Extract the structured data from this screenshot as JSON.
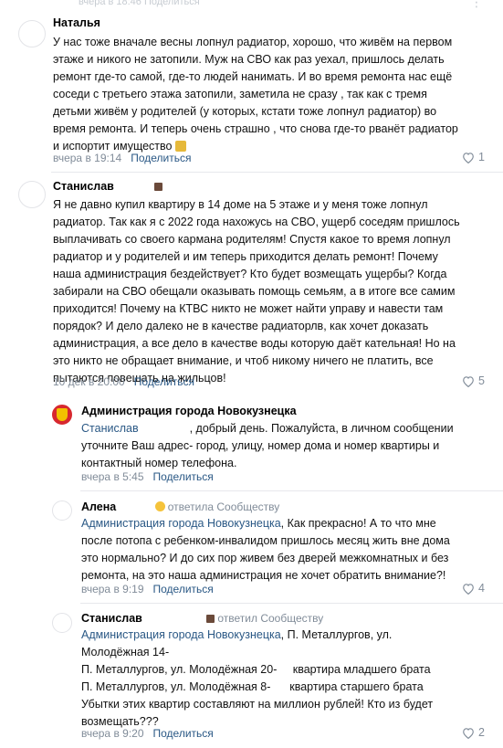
{
  "top_fragment": {
    "meta": "вчера в 18:46   Поделиться"
  },
  "comments": [
    {
      "name": "Наталья",
      "lines": [
        "У нас тоже вначале весны лопнул радиатор, хорошо, что живём на первом",
        "этаже и никого не затопили. Муж на СВО как раз уехал, пришлось делать",
        "ремонт где-то самой, где-то людей нанимать. И во время ремонта нас ещё",
        "соседи с третьего этажа затопили, заметила не сразу , так как с тремя",
        "детьми живём у родителей (у которых, кстати тоже лопнул радиатор) во",
        "время ремонта. И теперь очень страшно , что снова где-то рванёт радиатор",
        "и испортит имущество"
      ],
      "time": "вчера в 19:14",
      "share": "Поделиться",
      "likes": "1"
    },
    {
      "name": "Станислав",
      "lines": [
        "Я не давно купил квартиру в 14 доме на 5 этаже и у меня тоже лопнул",
        "радиатор. Так как я с 2022 года нахожусь на СВО, ущерб соседям пришлось",
        "выплачивать со своего кармана родителям! Спустя какое то время лопнул",
        "радиатор и у родителей и им теперь приходится делать ремонт! Почему",
        "наша администрация бездействует? Кто будет возмещать ущербы? Когда",
        "забирали на СВО обещали оказывать помощь семьям, а в итоге все самим",
        "приходится! Почему на КТВС никто не может найти управу и навести там",
        "порядок? И дело далеко не в качестве радиаторлв, как хочет доказать",
        "администрация, а все дело в качестве воды которую даёт кательная! Но на",
        "это никто не обращает внимание, и чтоб никому ничего не платить, все",
        "пытаются повешать на жильцов!"
      ],
      "time": "10 дек в 20:00",
      "share": "Поделиться",
      "likes": "5"
    },
    {
      "name": "Администрация города Новокузнецка",
      "mention": "Станислав",
      "lines": [
        ", добрый день. Пожалуйста, в личном сообщении",
        "уточните Ваш адрес- город, улицу, номер дома и номер квартиры и",
        "контактный номер телефона."
      ],
      "time": "вчера в 5:45",
      "share": "Поделиться"
    },
    {
      "name": "Алена",
      "replied": "ответила Сообществу",
      "mention": "Администрация города Новокузнецка",
      "lines": [
        ", Как прекрасно! А то что мне",
        "после потопа с ребенком-инвалидом пришлось месяц жить вне дома",
        "это нормально? И до сих пор живем без дверей межкомнатных и без",
        "ремонта, на это наша администрация не хочет обратить внимание?!"
      ],
      "time": "вчера в 9:19",
      "share": "Поделиться",
      "likes": "4"
    },
    {
      "name": "Станислав",
      "replied": "ответил Сообществу",
      "mention": "Администрация города Новокузнецка",
      "lines": [
        ", П. Металлургов, ул.",
        "Молодёжная 14-",
        "П. Металлургов, ул. Молодёжная 20-     квартира младшего брата",
        "П. Металлургов, ул. Молодёжная 8-      квартира старшего брата",
        "Убытки этих квартир составляют на миллион рублей! Кто из будет",
        "возмещать???"
      ],
      "time": "вчера в 9:20",
      "share": "Поделиться",
      "likes": "2"
    }
  ],
  "colors": {
    "link": "#2a5885",
    "meta": "#818c99",
    "divider": "#e7e8ec",
    "admin_avatar": "#d7282f"
  }
}
